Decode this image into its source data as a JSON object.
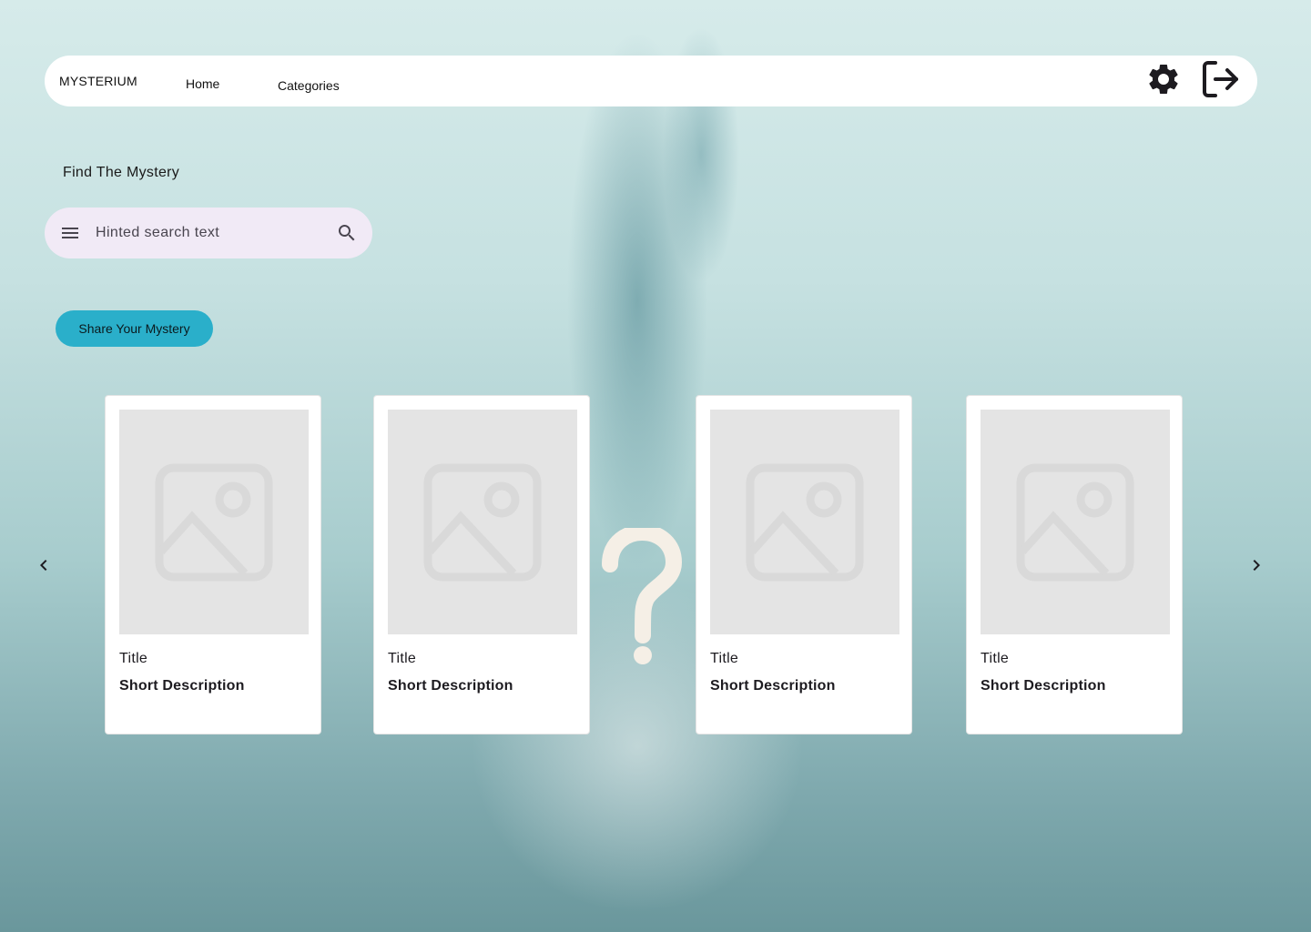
{
  "nav": {
    "brand": "MYSTERIUM",
    "links": [
      "Home",
      "Categories"
    ],
    "icons": [
      "gear-icon",
      "logout-icon"
    ]
  },
  "main": {
    "heading": "Find The Mystery",
    "search": {
      "placeholder": "Hinted search text"
    },
    "share_button": "Share Your Mystery"
  },
  "carousel": {
    "cards": [
      {
        "title": "Title",
        "description": "Short Description"
      },
      {
        "title": "Title",
        "description": "Short Description"
      },
      {
        "title": "Title",
        "description": "Short Description"
      },
      {
        "title": "Title",
        "description": "Short Description"
      }
    ]
  },
  "colors": {
    "accent": "#2aafca",
    "search_bg": "#f1eaf6",
    "placeholder_bg": "#e4e4e4"
  }
}
